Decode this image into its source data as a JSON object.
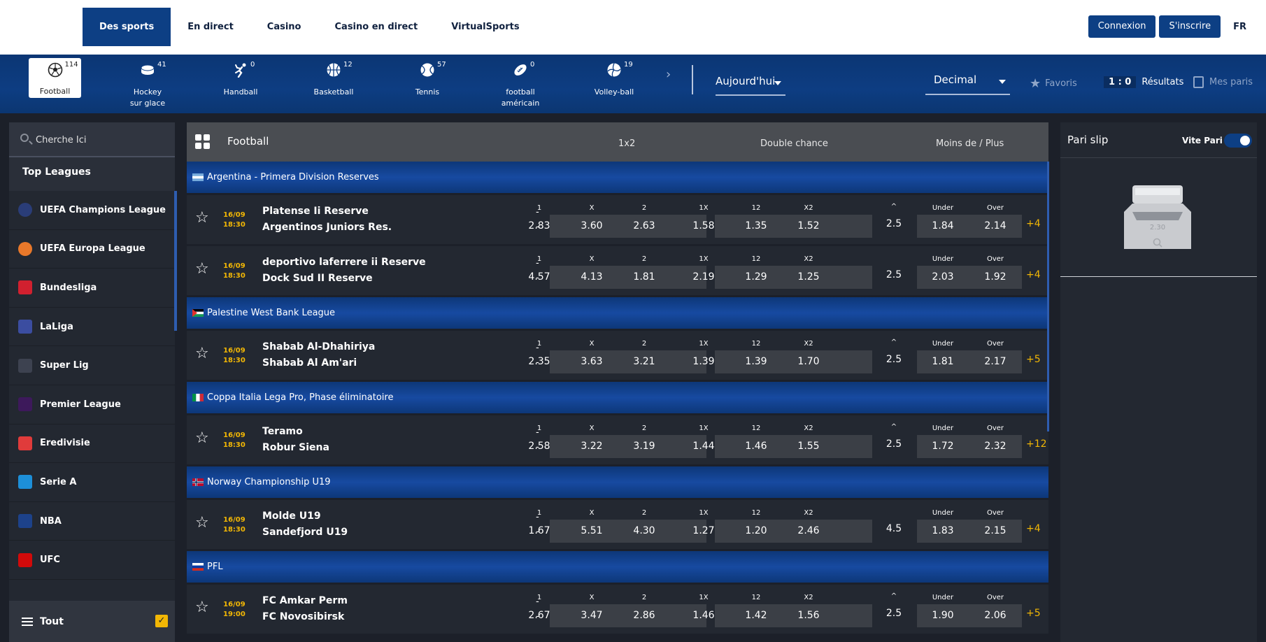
{
  "topnav": {
    "items": [
      "Des sports",
      "En direct",
      "Casino",
      "Casino en direct",
      "VirtualSports"
    ],
    "login": "Connexion",
    "register": "S'inscrire",
    "lang": "FR"
  },
  "sports": [
    {
      "label": "Football",
      "count": "114",
      "icon": "football-icon"
    },
    {
      "label": "Hockey sur glace",
      "count": "41",
      "icon": "hockey-puck-icon"
    },
    {
      "label": "Handball",
      "count": "0",
      "icon": "handball-icon"
    },
    {
      "label": "Basketball",
      "count": "12",
      "icon": "basketball-icon"
    },
    {
      "label": "Tennis",
      "count": "57",
      "icon": "tennis-ball-icon"
    },
    {
      "label": "football américain",
      "count": "0",
      "icon": "american-football-icon"
    },
    {
      "label": "Volley-ball",
      "count": "19",
      "icon": "volleyball-icon"
    }
  ],
  "toolbar": {
    "date": "Aujourd'hui",
    "odds_format": "Decimal",
    "favorites": "Favoris",
    "results_score": "1 : 0",
    "results": "Résultats",
    "my_bets": "Mes paris"
  },
  "sidebar": {
    "search_placeholder": "Cherche Ici",
    "top_leagues": "Top Leagues",
    "leagues": [
      {
        "name": "UEFA Champions League",
        "color": "#2a3d78"
      },
      {
        "name": "UEFA Europa League",
        "color": "#e8782a"
      },
      {
        "name": "Bundesliga",
        "color": "#d1202f"
      },
      {
        "name": "LaLiga",
        "color": "#3b4da0"
      },
      {
        "name": "Super Lig",
        "color": "#3d4250"
      },
      {
        "name": "Premier League",
        "color": "#3d195b"
      },
      {
        "name": "Eredivisie",
        "color": "#e03b3b"
      },
      {
        "name": "Serie A",
        "color": "#1d8fd8"
      },
      {
        "name": "NBA",
        "color": "#1d428a"
      },
      {
        "name": "UFC",
        "color": "#d20a0a"
      }
    ],
    "all_label": "Tout",
    "all_check": "✓"
  },
  "main": {
    "title": "Football",
    "col_1x2": "1x2",
    "col_double": "Double chance",
    "col_ou": "Moins de / Plus",
    "market_labels": [
      "1",
      "X",
      "2",
      "1X",
      "12",
      "X2",
      "Under",
      "Over"
    ],
    "dash": "-"
  },
  "leagues_events": [
    {
      "league": "Argentina - Primera Division Reserves",
      "flag": "argentina",
      "events": [
        {
          "date": "16/09",
          "time": "18:30",
          "home": "Platense Ii Reserve",
          "away": "Argentinos Juniors Res.",
          "odds": [
            "2.83",
            "3.60",
            "2.63",
            "1.58",
            "1.35",
            "1.52"
          ],
          "total": "2.5",
          "under": "1.84",
          "over": "2.14",
          "more": "+4",
          "chevron": true
        },
        {
          "date": "16/09",
          "time": "18:30",
          "home": "deportivo laferrere ii Reserve",
          "away": "Dock Sud II Reserve",
          "odds": [
            "4.57",
            "4.13",
            "1.81",
            "2.19",
            "1.29",
            "1.25"
          ],
          "total": "2.5",
          "under": "2.03",
          "over": "1.92",
          "more": "+4",
          "chevron": false
        }
      ]
    },
    {
      "league": "Palestine West Bank League",
      "flag": "palestine",
      "events": [
        {
          "date": "16/09",
          "time": "18:30",
          "home": "Shabab Al-Dhahiriya",
          "away": "Shabab Al Am'ari",
          "odds": [
            "2.35",
            "3.63",
            "3.21",
            "1.39",
            "1.39",
            "1.70"
          ],
          "total": "2.5",
          "under": "1.81",
          "over": "2.17",
          "more": "+5",
          "chevron": true
        }
      ]
    },
    {
      "league": "Coppa Italia Lega Pro, Phase éliminatoire",
      "flag": "italy",
      "events": [
        {
          "date": "16/09",
          "time": "18:30",
          "home": "Teramo",
          "away": "Robur Siena",
          "odds": [
            "2.58",
            "3.22",
            "3.19",
            "1.44",
            "1.46",
            "1.55"
          ],
          "total": "2.5",
          "under": "1.72",
          "over": "2.32",
          "more": "+12",
          "chevron": true
        }
      ]
    },
    {
      "league": "Norway Championship U19",
      "flag": "norway",
      "events": [
        {
          "date": "16/09",
          "time": "18:30",
          "home": "Molde U19",
          "away": "Sandefjord U19",
          "odds": [
            "1.67",
            "5.51",
            "4.30",
            "1.27",
            "1.20",
            "2.46"
          ],
          "total": "4.5",
          "under": "1.83",
          "over": "2.15",
          "more": "+4",
          "chevron": false
        }
      ]
    },
    {
      "league": "PFL",
      "flag": "russia",
      "events": [
        {
          "date": "16/09",
          "time": "19:00",
          "home": "FC Amkar Perm",
          "away": "FC Novosibirsk",
          "odds": [
            "2.67",
            "3.47",
            "2.86",
            "1.46",
            "1.42",
            "1.56"
          ],
          "total": "2.5",
          "under": "1.90",
          "over": "2.06",
          "more": "+5",
          "chevron": true
        }
      ]
    }
  ],
  "slip": {
    "title": "Pari slip",
    "quick": "Vite Pari",
    "illustration_value": "2.30"
  }
}
